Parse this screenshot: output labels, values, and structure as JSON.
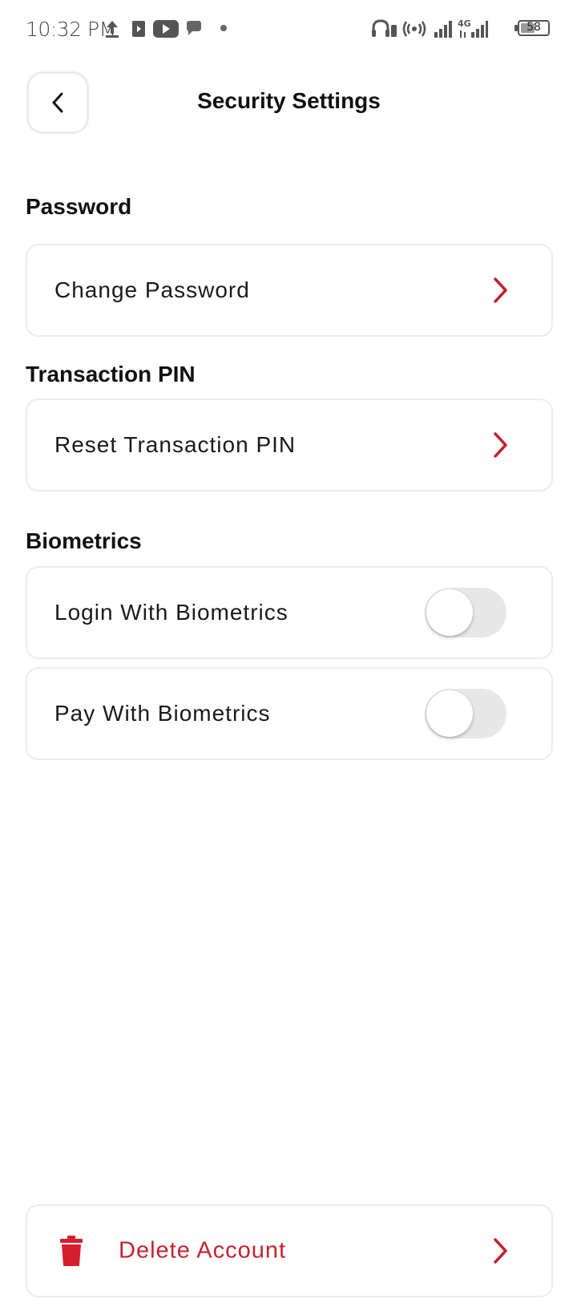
{
  "status_bar": {
    "time": "10:32 PM",
    "battery_level": "58",
    "battery_fraction": 0.58
  },
  "header": {
    "title": "Security Settings",
    "back_icon": "chevron-left-icon"
  },
  "sections": {
    "password": {
      "heading": "Password",
      "items": [
        {
          "label": "Change Password",
          "icon": "chevron-right-icon"
        }
      ]
    },
    "transaction_pin": {
      "heading": "Transaction PIN",
      "items": [
        {
          "label": "Reset Transaction PIN",
          "icon": "chevron-right-icon"
        }
      ]
    },
    "biometrics": {
      "heading": "Biometrics",
      "items": [
        {
          "label": "Login With Biometrics",
          "enabled": false
        },
        {
          "label": "Pay With Biometrics",
          "enabled": false
        }
      ]
    }
  },
  "delete_account": {
    "label": "Delete Account",
    "icon": "trash-icon",
    "chevron_icon": "chevron-right-icon"
  },
  "colors": {
    "accent_red": "#c8202e",
    "delete_text": "#c8202e",
    "card_border": "#ececec",
    "toggle_off_track": "#e7e7e7",
    "title_text": "#111111"
  }
}
